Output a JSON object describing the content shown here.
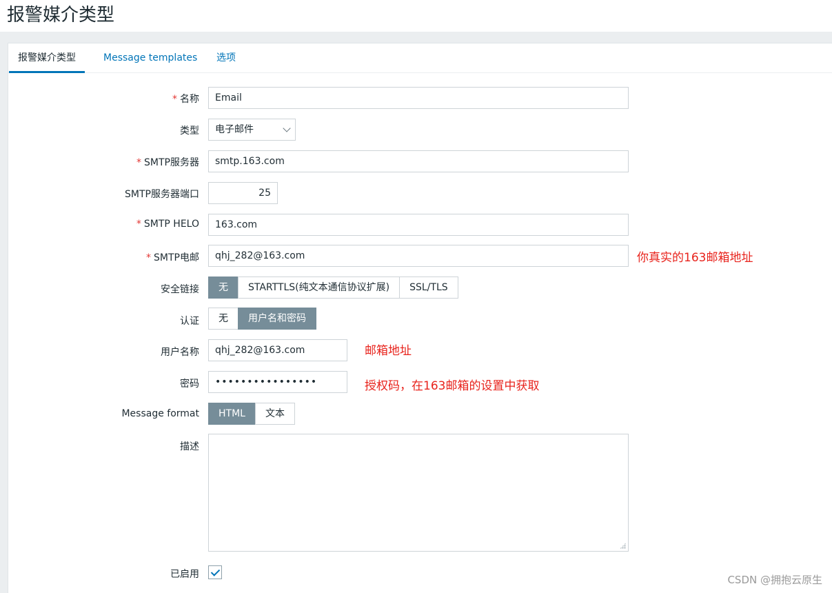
{
  "page": {
    "title": "报警媒介类型"
  },
  "tabs": [
    {
      "label": "报警媒介类型",
      "active": true
    },
    {
      "label": "Message templates",
      "active": false
    },
    {
      "label": "选项",
      "active": false
    }
  ],
  "form": {
    "required_mark": "*",
    "name": {
      "label": "名称",
      "value": "Email"
    },
    "type": {
      "label": "类型",
      "value": "电子邮件"
    },
    "smtp_server": {
      "label": "SMTP服务器",
      "value": "smtp.163.com"
    },
    "smtp_port": {
      "label": "SMTP服务器端口",
      "value": "25"
    },
    "smtp_helo": {
      "label": "SMTP HELO",
      "value": "163.com"
    },
    "smtp_email": {
      "label": "SMTP电邮",
      "value": "qhj_282@163.com"
    },
    "security": {
      "label": "安全链接",
      "options": [
        "无",
        "STARTTLS(纯文本通信协议扩展)",
        "SSL/TLS"
      ],
      "selected": "无"
    },
    "auth": {
      "label": "认证",
      "options": [
        "无",
        "用户名和密码"
      ],
      "selected": "用户名和密码"
    },
    "username": {
      "label": "用户名称",
      "value": "qhj_282@163.com"
    },
    "password": {
      "label": "密码",
      "value": "••••••••••••••••"
    },
    "message_format": {
      "label": "Message format",
      "options": [
        "HTML",
        "文本"
      ],
      "selected": "HTML"
    },
    "description": {
      "label": "描述",
      "value": ""
    },
    "enabled": {
      "label": "已启用",
      "checked": true
    }
  },
  "annotations": {
    "smtp_email_note": "你真实的163邮箱地址",
    "username_note": "邮箱地址",
    "password_note": "授权码，在163邮箱的设置中获取"
  },
  "watermark": "CSDN @拥抱云原生",
  "colors": {
    "accent": "#0275b8",
    "segment_active": "#768d99",
    "required": "#e33734",
    "annotation": "#e8231c"
  }
}
